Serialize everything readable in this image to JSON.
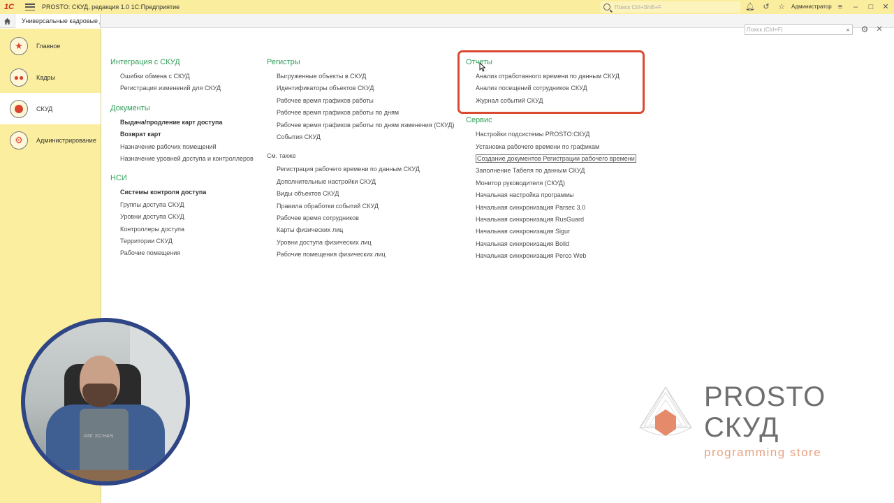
{
  "titlebar": {
    "logo": "1С",
    "title": "PROSTO: СКУД, редакция 1.0 1С:Предприятие",
    "search_placeholder": "Поиск Ctrl+Shift+F",
    "user": "Администратор"
  },
  "tabs": {
    "open_tab": "Универсальные кадровые д"
  },
  "sidebar": {
    "items": [
      {
        "label": "Главное"
      },
      {
        "label": "Кадры"
      },
      {
        "label": "СКУД"
      },
      {
        "label": "Администрирование"
      }
    ]
  },
  "panel": {
    "search_placeholder": "Поиск (Ctrl+F)"
  },
  "col1": {
    "integration": {
      "title": "Интеграция с СКУД",
      "links": [
        "Ошибки обмена с СКУД",
        "Регистрация изменений для СКУД"
      ]
    },
    "documents": {
      "title": "Документы",
      "links": [
        "Выдача/продление карт доступа",
        "Возврат карт",
        "Назначение рабочих помещений",
        "Назначение уровней доступа и контроллеров"
      ]
    },
    "nsi": {
      "title": "НСИ",
      "links": [
        "Системы контроля доступа",
        "Группы доступа СКУД",
        "Уровни доступа СКУД",
        "Контроллеры доступа",
        "Территории СКУД",
        "Рабочие помещения"
      ]
    }
  },
  "col2": {
    "registers": {
      "title": "Регистры",
      "links": [
        "Выгруженные объекты в СКУД",
        "Идентификаторы объектов СКУД",
        "Рабочее время графиков работы",
        "Рабочее время графиков работы по дням",
        "Рабочее время графиков работы по дням изменения (СКУД)",
        "События СКУД"
      ]
    },
    "see_also": {
      "title": "См. также",
      "links": [
        "Регистрация рабочего времени по данным СКУД",
        "Дополнительные настройки СКУД",
        "Виды объектов СКУД",
        "Правила обработки событий СКУД",
        "Рабочее время сотрудников",
        "Карты физических лиц",
        "Уровни доступа физических лиц",
        "Рабочие помещения физических лиц"
      ]
    }
  },
  "col3": {
    "reports": {
      "title": "Отчеты",
      "links": [
        "Анализ отработанного времени по данным СКУД",
        "Анализ посещений сотрудников СКУД",
        "Журнал событий СКУД"
      ]
    },
    "service": {
      "title": "Сервис",
      "links": [
        "Настройки подсистемы PROSTO:СКУД",
        "Установка рабочего времени по графикам",
        "Создание документов Регистрации рабочего времени",
        "Заполнение Табеля по данным СКУД",
        "Монитор руководителя (СКУД)",
        "Начальная настройка программы",
        "Начальная синхронизация Parsec 3.0",
        "Начальная синхронизация RusGuard",
        "Начальная синхронизация Sigur",
        "Начальная синхронизация Bolid",
        "Начальная синхронизация Perco Web"
      ]
    }
  },
  "video": {
    "shirt_text": "ANI XCHAN"
  },
  "watermark": {
    "line1": "PROSTO",
    "line2": "СКУД",
    "line3": "programming store"
  },
  "colors": {
    "accent_green": "#2f9e58",
    "title_bar": "#fbed9e",
    "highlight": "#d94a31"
  }
}
